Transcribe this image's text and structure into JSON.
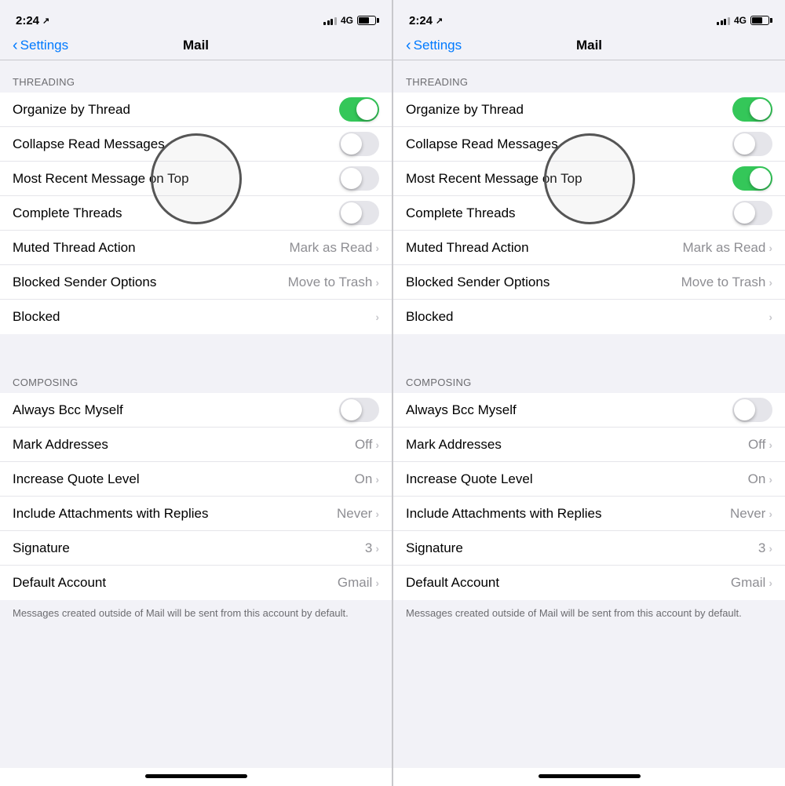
{
  "left_panel": {
    "status": {
      "time": "2:24",
      "location": "↗",
      "lte": "4G"
    },
    "nav": {
      "back_label": "Settings",
      "title": "Mail"
    },
    "threading_section": {
      "header": "THREADING",
      "items": [
        {
          "label": "Organize by Thread",
          "type": "toggle",
          "state": "on"
        },
        {
          "label": "Collapse Read Messages",
          "type": "toggle",
          "state": "off",
          "highlighted": false
        },
        {
          "label": "Most Recent Message on Top",
          "type": "toggle",
          "state": "off",
          "highlighted": true
        },
        {
          "label": "Complete Threads",
          "type": "toggle",
          "state": "off"
        },
        {
          "label": "Muted Thread Action",
          "type": "value",
          "value": "Mark as Read"
        },
        {
          "label": "Blocked Sender Options",
          "type": "value",
          "value": "Move to Trash"
        },
        {
          "label": "Blocked",
          "type": "chevron"
        }
      ]
    },
    "composing_section": {
      "header": "COMPOSING",
      "items": [
        {
          "label": "Always Bcc Myself",
          "type": "toggle",
          "state": "off"
        },
        {
          "label": "Mark Addresses",
          "type": "value",
          "value": "Off"
        },
        {
          "label": "Increase Quote Level",
          "type": "value",
          "value": "On"
        },
        {
          "label": "Include Attachments with Replies",
          "type": "value",
          "value": "Never"
        },
        {
          "label": "Signature",
          "type": "value",
          "value": "3"
        },
        {
          "label": "Default Account",
          "type": "value",
          "value": "Gmail"
        }
      ]
    },
    "footer": "Messages created outside of Mail will be sent from this account by default."
  },
  "right_panel": {
    "status": {
      "time": "2:24",
      "location": "↗",
      "lte": "4G"
    },
    "nav": {
      "back_label": "Settings",
      "title": "Mail"
    },
    "threading_section": {
      "header": "THREADING",
      "items": [
        {
          "label": "Organize by Thread",
          "type": "toggle",
          "state": "on"
        },
        {
          "label": "Collapse Read Messages",
          "type": "toggle",
          "state": "off",
          "highlighted": false
        },
        {
          "label": "Most Recent Message on Top",
          "type": "toggle",
          "state": "on",
          "highlighted": true
        },
        {
          "label": "Complete Threads",
          "type": "toggle",
          "state": "off"
        },
        {
          "label": "Muted Thread Action",
          "type": "value",
          "value": "Mark as Read"
        },
        {
          "label": "Blocked Sender Options",
          "type": "value",
          "value": "Move to Trash"
        },
        {
          "label": "Blocked",
          "type": "chevron"
        }
      ]
    },
    "composing_section": {
      "header": "COMPOSING",
      "items": [
        {
          "label": "Always Bcc Myself",
          "type": "toggle",
          "state": "off"
        },
        {
          "label": "Mark Addresses",
          "type": "value",
          "value": "Off"
        },
        {
          "label": "Increase Quote Level",
          "type": "value",
          "value": "On"
        },
        {
          "label": "Include Attachments with Replies",
          "type": "value",
          "value": "Never"
        },
        {
          "label": "Signature",
          "type": "value",
          "value": "3"
        },
        {
          "label": "Default Account",
          "type": "value",
          "value": "Gmail"
        }
      ]
    },
    "footer": "Messages created outside of Mail will be sent from this account by default."
  }
}
